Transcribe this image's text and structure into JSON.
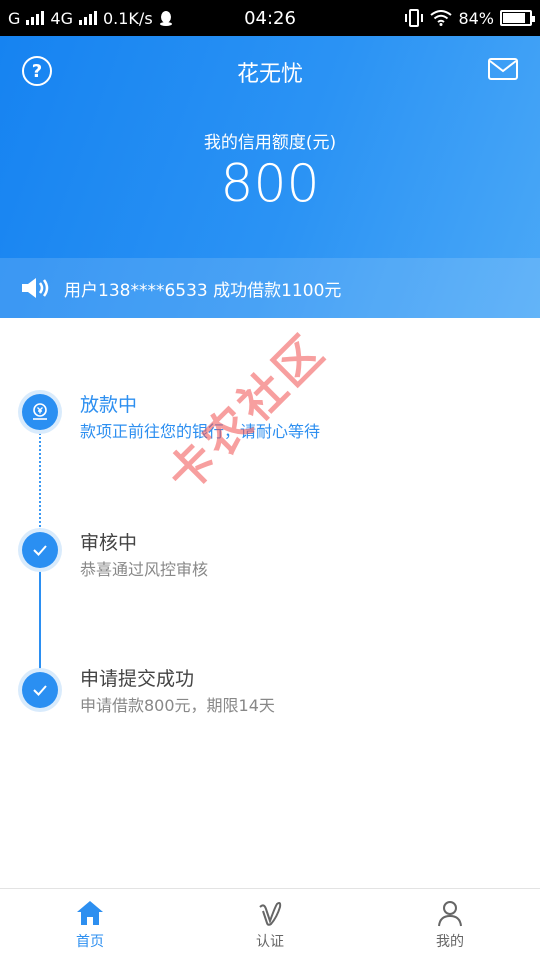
{
  "status_bar": {
    "carrier_left": "G",
    "network": "4G",
    "speed": "0.1K/s",
    "time": "04:26",
    "battery": "84%",
    "battery_level": 0.84
  },
  "header": {
    "title": "花无忧",
    "help_icon": "?",
    "credit_label": "我的信用额度(元)",
    "credit_value": "800"
  },
  "notice": {
    "text": "用户138****6533 成功借款1100元"
  },
  "steps": [
    {
      "title": "放款中",
      "desc": "款项正前往您的银行，请耐心等待",
      "state": "active"
    },
    {
      "title": "审核中",
      "desc": "恭喜通过风控审核",
      "state": "done"
    },
    {
      "title": "申请提交成功",
      "desc": "申请借款800元，期限14天",
      "state": "done"
    }
  ],
  "watermark": "卡农社区",
  "tabs": [
    {
      "label": "首页",
      "icon": "home-icon",
      "active": true
    },
    {
      "label": "认证",
      "icon": "verify-icon",
      "active": false
    },
    {
      "label": "我的",
      "icon": "profile-icon",
      "active": false
    }
  ],
  "colors": {
    "primary": "#2d8ff0",
    "header_start": "#1683f1",
    "header_end": "#4aa8f7",
    "watermark": "#f05050"
  }
}
